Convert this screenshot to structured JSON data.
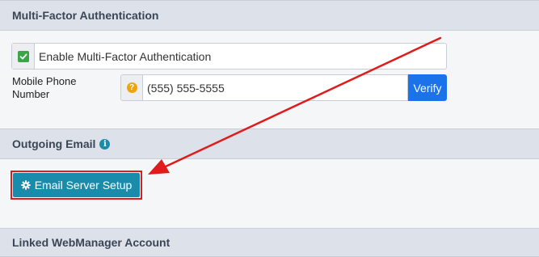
{
  "mfa_section": {
    "title": "Multi-Factor Authentication",
    "enable_label": "Enable Multi-Factor Authentication",
    "enabled": true,
    "phone_label": "Mobile Phone Number",
    "phone_value": "(555) 555-5555",
    "help_icon": "question-circle-icon",
    "verify_label": "Verify"
  },
  "email_section": {
    "title": "Outgoing Email",
    "info_icon": "info-circle-icon",
    "setup_button_icon": "gear-icon",
    "setup_button_label": "Email Server Setup"
  },
  "linked_section": {
    "title": "Linked WebManager Account"
  },
  "annotation": {
    "highlight_color": "#e01b1b",
    "arrow_color": "#e01b1b"
  },
  "colors": {
    "header_bg": "#dde2ea",
    "verify_blue": "#1a73e8",
    "teal": "#1a8cab",
    "check_green": "#3aa546",
    "help_orange": "#f0a500"
  }
}
